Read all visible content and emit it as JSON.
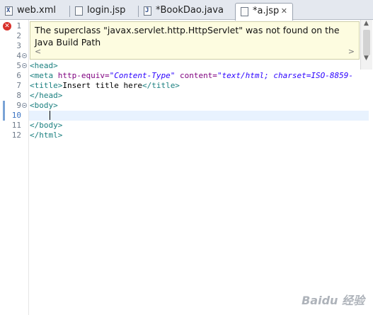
{
  "tabs": [
    {
      "label": "web.xml",
      "icon": "xml-file-icon",
      "glyph": "X"
    },
    {
      "label": "login.jsp",
      "icon": "jsp-file-icon",
      "glyph": ""
    },
    {
      "label": "*BookDao.java",
      "icon": "java-file-icon",
      "glyph": "J"
    },
    {
      "label": "*a.jsp",
      "icon": "jsp-file-icon",
      "glyph": "",
      "active": true,
      "close": "✕"
    }
  ],
  "editor": {
    "line_numbers": [
      "1",
      "2",
      "3",
      "4",
      "5",
      "6",
      "7",
      "8",
      "9",
      "10",
      "11",
      "12"
    ],
    "error_message": "The superclass \"javax.servlet.http.HttpServlet\" was not found on the Java Build Path",
    "scroll_left": "<",
    "scroll_right": ">",
    "code": {
      "l5": "<head>",
      "l6_tag": "<meta",
      "l6_attr1": " http-equiv=",
      "l6_val1": "\"Content-Type\"",
      "l6_attr2": " content=",
      "l6_val2": "\"text/html; charset=ISO-8859-",
      "l7_open": "<title>",
      "l7_text": "Insert title here",
      "l7_close": "</title>",
      "l8": "</head>",
      "l9": "<body>",
      "l11": "</body>",
      "l12": "</html>"
    }
  },
  "watermark": "Baidu 经验",
  "colors": {
    "error": "#d9312b",
    "tag": "#1a7f7f",
    "attr": "#7f007f",
    "value": "#2a00ff",
    "current_line": "#e8f2fe"
  }
}
